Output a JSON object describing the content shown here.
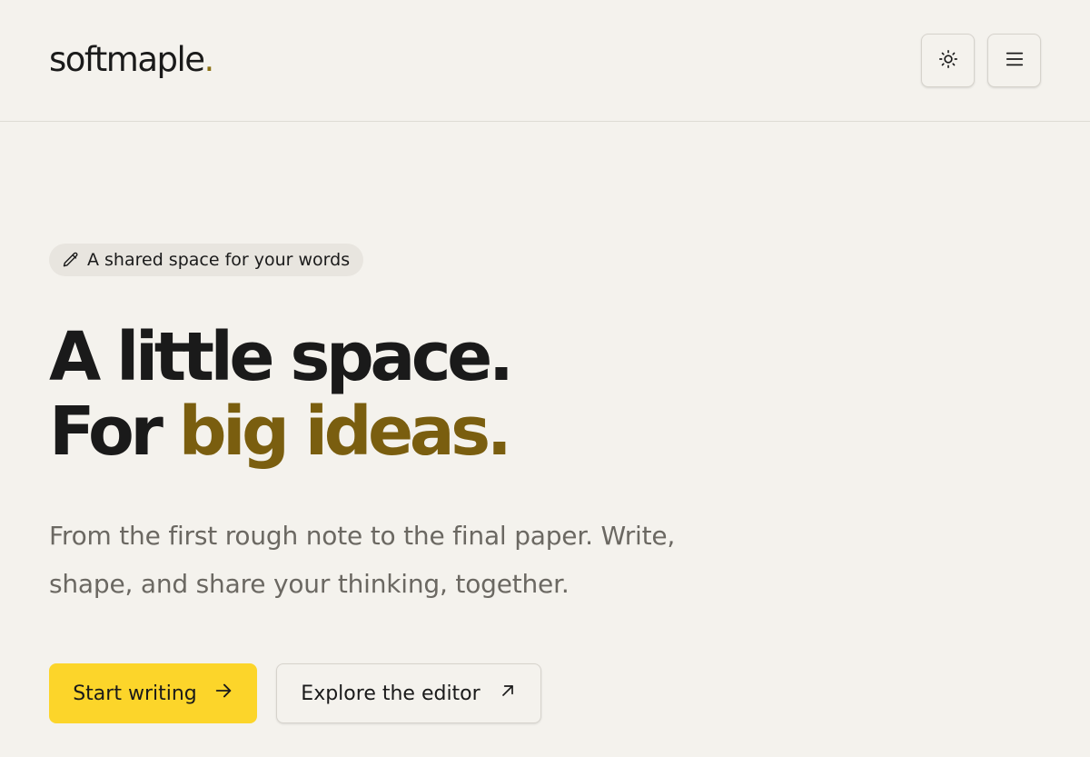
{
  "header": {
    "logo_text": "softmaple",
    "logo_dot": ".",
    "theme_toggle_icon": "sun-icon",
    "menu_icon": "hamburger-menu-icon"
  },
  "hero": {
    "eyebrow": {
      "icon": "pencil-icon",
      "label": "A shared space for your words"
    },
    "headline_line1": "A little space.",
    "headline_line2_plain": "For ",
    "headline_line2_accent": "big ideas.",
    "subtext": "From the first rough note to the final paper. Write, shape, and share your thinking, together.",
    "primary_cta": {
      "label": "Start writing",
      "icon": "arrow-right-icon"
    },
    "secondary_cta": {
      "label": "Explore the editor",
      "icon": "arrow-up-right-icon"
    }
  },
  "colors": {
    "background": "#f4f2ed",
    "accent": "#7a5e0f",
    "primary_button": "#fcd52a",
    "text": "#1a1a1a",
    "muted_text": "#6b6862"
  }
}
